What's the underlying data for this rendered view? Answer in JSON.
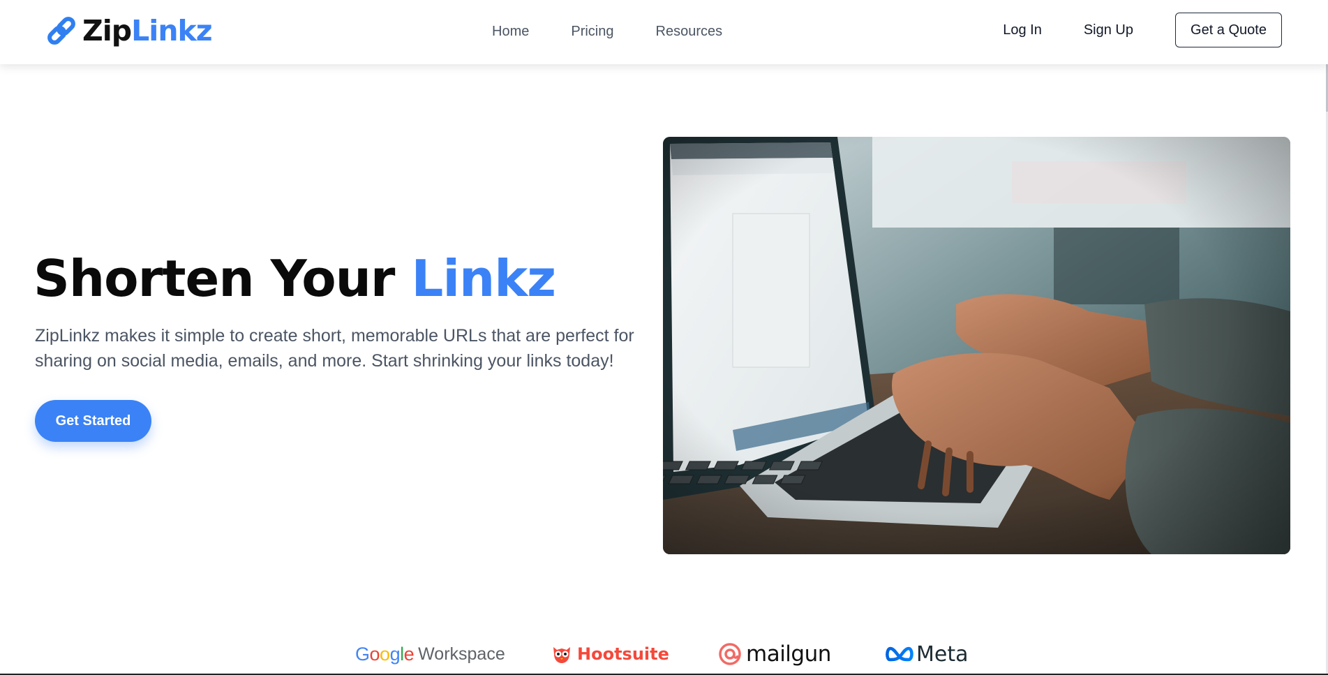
{
  "brand": {
    "name_part1": "Zip",
    "name_part2": "Linkz",
    "icon": "link-chain-icon",
    "accent_color": "#3b82f6"
  },
  "nav": {
    "items": [
      {
        "label": "Home"
      },
      {
        "label": "Pricing"
      },
      {
        "label": "Resources"
      }
    ]
  },
  "auth": {
    "login_label": "Log In",
    "signup_label": "Sign Up",
    "quote_label": "Get a Quote"
  },
  "hero": {
    "title_part1": "Shorten Your ",
    "title_accent": "Linkz",
    "description": "ZipLinkz makes it simple to create short, memorable URLs that are perfect for sharing on social media, emails, and more. Start shrinking your links today!",
    "cta_label": "Get Started",
    "image_subject": "hands typing on laptop keyboard"
  },
  "partners": {
    "google_letters": [
      "G",
      "o",
      "o",
      "g",
      "l",
      "e"
    ],
    "google_colors": [
      "#4285F4",
      "#EA4335",
      "#FBBC05",
      "#4285F4",
      "#34A853",
      "#EA4335"
    ],
    "workspace_label": "Workspace",
    "hootsuite_label": "Hootsuite",
    "hootsuite_icon": "owl-icon",
    "mailgun_label": "mailgun",
    "mailgun_icon": "at-sign-icon",
    "meta_label": "Meta",
    "meta_icon": "infinity-icon"
  }
}
